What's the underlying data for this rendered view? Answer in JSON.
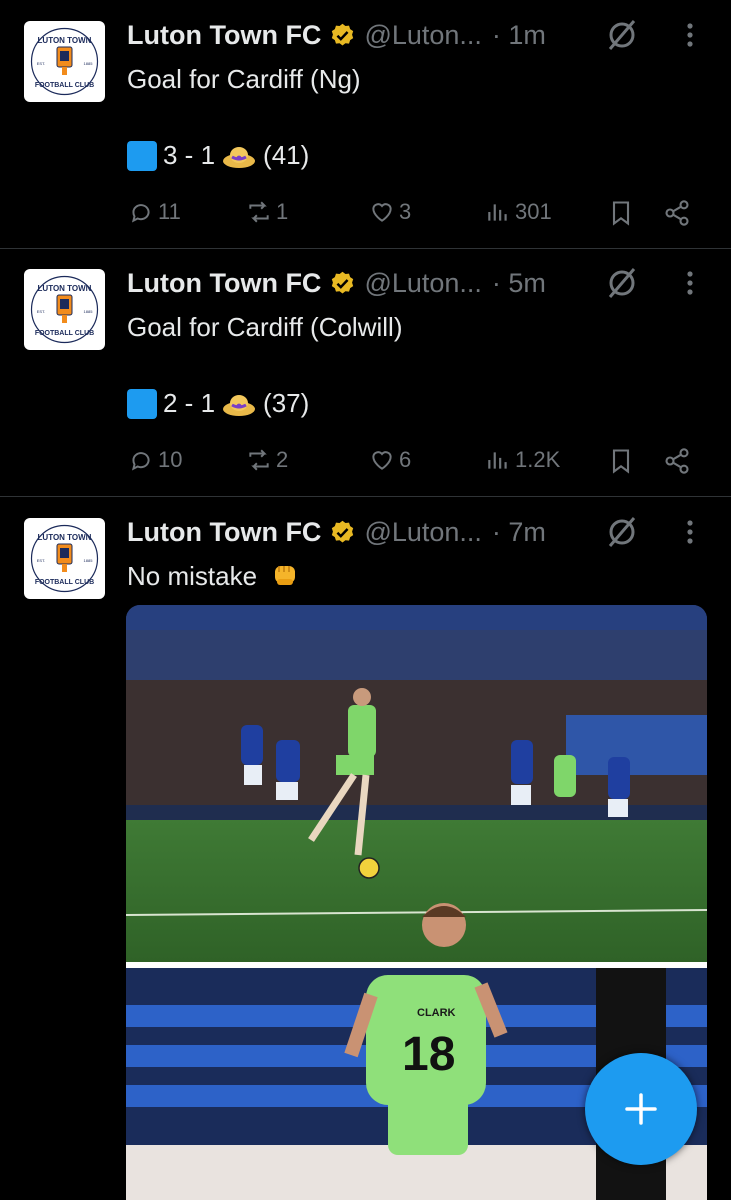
{
  "colors": {
    "accent": "#1d9bf0",
    "muted": "#71767b",
    "text": "#e7e9ea",
    "background": "#000000"
  },
  "avatar": {
    "line1": "LUTON TOWN",
    "line2": "FOOTBALL CLUB",
    "est": "EST.",
    "year": "1885"
  },
  "tweets": [
    {
      "name": "Luton Town FC",
      "handle": "@Luton...",
      "time": "· 1m",
      "text": "Goal for Cardiff (Ng)",
      "score": "3 - 1",
      "minute": "(41)",
      "replies": "11",
      "reposts": "1",
      "likes": "3",
      "views": "301"
    },
    {
      "name": "Luton Town FC",
      "handle": "@Luton...",
      "time": "· 5m",
      "text": "Goal for Cardiff (Colwill)",
      "score": "2 - 1",
      "minute": "(37)",
      "replies": "10",
      "reposts": "2",
      "likes": "6",
      "views": "1.2K"
    },
    {
      "name": "Luton Town FC",
      "handle": "@Luton...",
      "time": "· 7m",
      "text": "No mistake",
      "photo2_shirt_name": "CLARK",
      "photo2_shirt_number": "18"
    }
  ],
  "icons": {
    "verified": "verified-badge-icon",
    "grok": "grok-icon",
    "more": "more-options-icon",
    "reply": "reply-icon",
    "repost": "repost-icon",
    "like": "like-icon",
    "views": "views-icon",
    "bookmark": "bookmark-icon",
    "share": "share-icon",
    "compose": "compose-plus-icon"
  }
}
